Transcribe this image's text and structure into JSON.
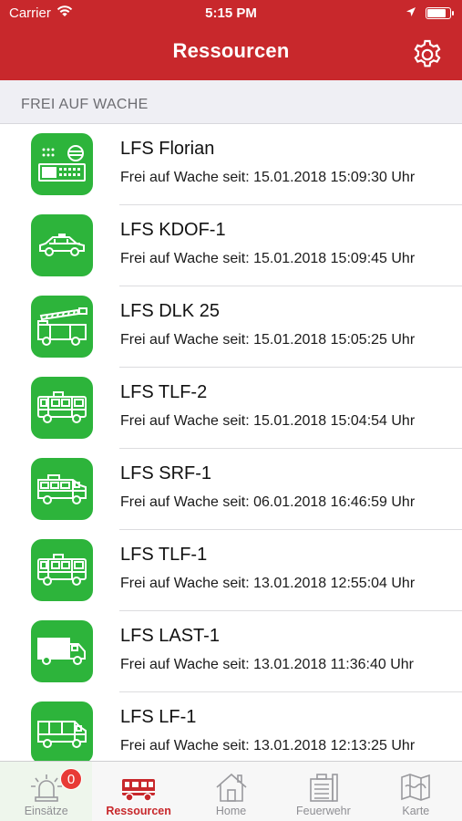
{
  "status_bar": {
    "carrier": "Carrier",
    "time": "5:15 PM",
    "battery_level": 0.85
  },
  "nav": {
    "title": "Ressourcen"
  },
  "section": {
    "header": "FREI AUF WACHE"
  },
  "resources": [
    {
      "name": "LFS Florian",
      "status": "Frei auf Wache seit: 15.01.2018 15:09:30 Uhr",
      "icon": "radio-station-icon"
    },
    {
      "name": "LFS KDOF-1",
      "status": "Frei auf Wache seit: 15.01.2018 15:09:45 Uhr",
      "icon": "command-car-icon"
    },
    {
      "name": "LFS DLK 25",
      "status": "Frei auf Wache seit: 15.01.2018 15:05:25 Uhr",
      "icon": "ladder-truck-icon"
    },
    {
      "name": "LFS TLF-2",
      "status": "Frei auf Wache seit: 15.01.2018 15:04:54 Uhr",
      "icon": "fire-truck-icon"
    },
    {
      "name": "LFS SRF-1",
      "status": "Frei auf Wache seit: 06.01.2018 16:46:59 Uhr",
      "icon": "rescue-truck-icon"
    },
    {
      "name": "LFS TLF-1",
      "status": "Frei auf Wache seit: 13.01.2018 12:55:04 Uhr",
      "icon": "fire-truck-icon"
    },
    {
      "name": "LFS LAST-1",
      "status": "Frei auf Wache seit: 13.01.2018 11:36:40 Uhr",
      "icon": "cargo-truck-icon"
    },
    {
      "name": "LFS LF-1",
      "status": "Frei auf Wache seit: 13.01.2018 12:13:25 Uhr",
      "icon": "fire-engine-icon"
    }
  ],
  "tabs": [
    {
      "label": "Einsätze",
      "icon": "siren-icon",
      "badge": "0"
    },
    {
      "label": "Ressourcen",
      "icon": "fire-truck-icon",
      "active": true
    },
    {
      "label": "Home",
      "icon": "house-icon"
    },
    {
      "label": "Feuerwehr",
      "icon": "fire-station-icon"
    },
    {
      "label": "Karte",
      "icon": "map-icon"
    }
  ],
  "colors": {
    "brand": "#c8282c",
    "icon_green": "#2db43b",
    "badge": "#e83a36"
  }
}
